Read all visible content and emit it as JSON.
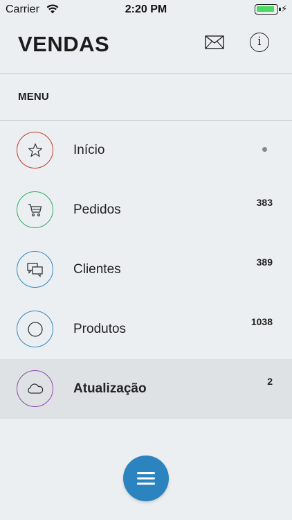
{
  "status_bar": {
    "carrier": "Carrier",
    "time": "2:20 PM",
    "battery_level": 0.85,
    "battery_color": "#4cd964"
  },
  "header": {
    "title": "VENDAS",
    "mail_icon": "mail-icon",
    "info_icon": "info-icon",
    "info_glyph": "i"
  },
  "menu": {
    "section_label": "MENU",
    "items": [
      {
        "label": "Início",
        "icon": "star-icon",
        "ring_color": "#c0392b",
        "count": null,
        "has_dot": true,
        "active": false
      },
      {
        "label": "Pedidos",
        "icon": "cart-icon",
        "ring_color": "#27ae60",
        "count": "383",
        "has_dot": false,
        "active": false
      },
      {
        "label": "Clientes",
        "icon": "chat-bubbles-icon",
        "ring_color": "#2e86c1",
        "count": "389",
        "has_dot": false,
        "active": false
      },
      {
        "label": "Produtos",
        "icon": "circle-icon",
        "ring_color": "#2e86c1",
        "count": "1038",
        "has_dot": false,
        "active": false
      },
      {
        "label": "Atualização",
        "icon": "cloud-icon",
        "ring_color": "#8e44ad",
        "count": "2",
        "has_dot": false,
        "active": true
      }
    ]
  },
  "fab": {
    "icon": "hamburger-menu-icon",
    "color": "#2b83c0"
  }
}
